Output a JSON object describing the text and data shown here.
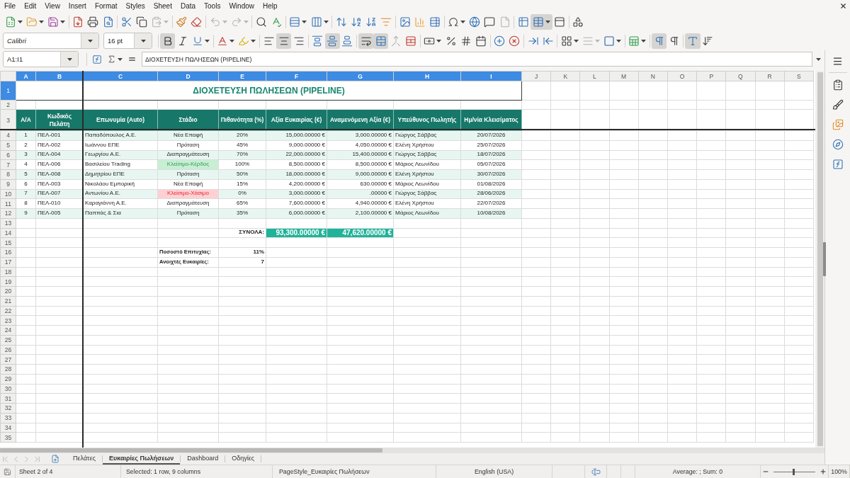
{
  "menu_bar": [
    "File",
    "Edit",
    "View",
    "Insert",
    "Format",
    "Styles",
    "Sheet",
    "Data",
    "Tools",
    "Window",
    "Help"
  ],
  "standard_toolbar": [
    [
      {
        "kind": "new",
        "active": false,
        "disabled": false
      },
      {
        "kind": "open",
        "active": false,
        "disabled": false
      },
      {
        "kind": "save",
        "active": false,
        "disabled": false
      }
    ],
    [
      {
        "kind": "export_pdf",
        "active": false,
        "disabled": false
      },
      {
        "kind": "print",
        "active": false,
        "disabled": false
      },
      {
        "kind": "print_preview",
        "active": false,
        "disabled": false
      }
    ],
    [
      {
        "kind": "cut",
        "active": false,
        "disabled": false
      },
      {
        "kind": "copy",
        "active": false,
        "disabled": false
      },
      {
        "kind": "paste",
        "active": false,
        "disabled": true
      }
    ],
    [
      {
        "kind": "clone_formatting",
        "active": false,
        "disabled": false
      },
      {
        "kind": "clear_formatting",
        "active": false,
        "disabled": false
      }
    ],
    [
      {
        "kind": "undo",
        "active": false,
        "disabled": true
      },
      {
        "kind": "redo",
        "active": false,
        "disabled": true
      }
    ],
    [
      {
        "kind": "find_replace",
        "active": false,
        "disabled": false
      },
      {
        "kind": "spelling",
        "active": false,
        "disabled": false
      }
    ],
    [
      {
        "kind": "row",
        "active": false,
        "disabled": false
      },
      {
        "kind": "column",
        "active": false,
        "disabled": false
      }
    ],
    [
      {
        "kind": "sort",
        "active": false,
        "disabled": false
      },
      {
        "kind": "sort_ascending",
        "active": false,
        "disabled": false
      },
      {
        "kind": "sort_descending",
        "active": false,
        "disabled": false
      },
      {
        "kind": "autofilter",
        "active": false,
        "disabled": false
      }
    ],
    [
      {
        "kind": "image",
        "active": false,
        "disabled": false
      },
      {
        "kind": "chart",
        "active": false,
        "disabled": false
      },
      {
        "kind": "pivot_table",
        "active": false,
        "disabled": false
      }
    ],
    [
      {
        "kind": "special_character",
        "active": false,
        "disabled": false
      },
      {
        "kind": "hyperlink",
        "active": false,
        "disabled": false
      },
      {
        "kind": "comment",
        "active": false,
        "disabled": false
      },
      {
        "kind": "header_footer",
        "active": false,
        "disabled": true
      }
    ],
    [
      {
        "kind": "print_area",
        "active": false,
        "disabled": false
      },
      {
        "kind": "freeze",
        "active": true,
        "disabled": false
      },
      {
        "kind": "split_window",
        "active": false,
        "disabled": false
      }
    ],
    [
      {
        "kind": "shapes",
        "active": false,
        "disabled": false
      }
    ]
  ],
  "font": {
    "name": "Calibri",
    "size": "16 pt"
  },
  "format_toolbar": [
    [
      {
        "kind": "bold",
        "active": true,
        "disabled": false
      },
      {
        "kind": "italic",
        "active": false,
        "disabled": false
      },
      {
        "kind": "underline",
        "active": false,
        "disabled": false
      }
    ],
    [
      {
        "kind": "font_color",
        "active": false,
        "disabled": false
      },
      {
        "kind": "highlight",
        "active": false,
        "disabled": false
      }
    ],
    [
      {
        "kind": "align_left",
        "active": false,
        "disabled": false
      },
      {
        "kind": "align_center",
        "active": true,
        "disabled": false
      },
      {
        "kind": "align_right",
        "active": false,
        "disabled": false
      }
    ],
    [
      {
        "kind": "align_top",
        "active": false,
        "disabled": false
      },
      {
        "kind": "align_middle",
        "active": true,
        "disabled": false
      },
      {
        "kind": "align_bottom",
        "active": false,
        "disabled": false
      }
    ],
    [
      {
        "kind": "wrap_text",
        "active": true,
        "disabled": false
      },
      {
        "kind": "merge_center",
        "active": true,
        "disabled": false
      },
      {
        "kind": "merge",
        "active": false,
        "disabled": true
      },
      {
        "kind": "unmerge",
        "active": false,
        "disabled": false
      }
    ],
    [
      {
        "kind": "currency",
        "active": false,
        "disabled": false
      },
      {
        "kind": "percent",
        "active": false,
        "disabled": false
      },
      {
        "kind": "number",
        "active": false,
        "disabled": false
      },
      {
        "kind": "date",
        "active": false,
        "disabled": false
      }
    ],
    [
      {
        "kind": "add_decimal",
        "active": false,
        "disabled": false
      },
      {
        "kind": "delete_decimal",
        "active": false,
        "disabled": false
      }
    ],
    [
      {
        "kind": "indent_increase",
        "active": false,
        "disabled": false
      },
      {
        "kind": "indent_decrease",
        "active": false,
        "disabled": false
      }
    ],
    [
      {
        "kind": "borders",
        "active": false,
        "disabled": false
      },
      {
        "kind": "border_style",
        "active": false,
        "disabled": true
      },
      {
        "kind": "border_color",
        "active": false,
        "disabled": false
      }
    ],
    [
      {
        "kind": "conditional",
        "active": false,
        "disabled": false
      }
    ],
    [
      {
        "kind": "left_to_right",
        "active": true,
        "disabled": false
      },
      {
        "kind": "right_to_left",
        "active": false,
        "disabled": false
      }
    ],
    [
      {
        "kind": "text_horizontal",
        "active": true,
        "disabled": false
      },
      {
        "kind": "text_vertical",
        "active": false,
        "disabled": false
      }
    ]
  ],
  "formula_bar": {
    "name_box": "A1:I1",
    "content": "ΔΙΟΧΕΤΕΥΣΗ ΠΩΛΗΣΕΩΝ (PIPELINE)"
  },
  "sheet": {
    "columns": [
      {
        "label": "A",
        "selected": true
      },
      {
        "label": "B",
        "selected": true
      },
      {
        "label": "C",
        "selected": true
      },
      {
        "label": "D",
        "selected": true
      },
      {
        "label": "E",
        "selected": true
      },
      {
        "label": "F",
        "selected": true
      },
      {
        "label": "G",
        "selected": true
      },
      {
        "label": "H",
        "selected": true
      },
      {
        "label": "I",
        "selected": true
      },
      {
        "label": "J",
        "selected": false
      },
      {
        "label": "K",
        "selected": false
      },
      {
        "label": "L",
        "selected": false
      },
      {
        "label": "M",
        "selected": false
      },
      {
        "label": "N",
        "selected": false
      },
      {
        "label": "O",
        "selected": false
      },
      {
        "label": "P",
        "selected": false
      },
      {
        "label": "Q",
        "selected": false
      },
      {
        "label": "R",
        "selected": false
      },
      {
        "label": "S",
        "selected": false
      }
    ],
    "row_numbers": [
      {
        "label": "1",
        "selected": true
      },
      {
        "label": "2",
        "selected": false
      },
      {
        "label": "3",
        "selected": false
      },
      {
        "label": "4",
        "selected": false
      },
      {
        "label": "5",
        "selected": false
      },
      {
        "label": "6",
        "selected": false
      },
      {
        "label": "7",
        "selected": false
      },
      {
        "label": "8",
        "selected": false
      },
      {
        "label": "9",
        "selected": false
      },
      {
        "label": "10",
        "selected": false
      },
      {
        "label": "11",
        "selected": false
      },
      {
        "label": "12",
        "selected": false
      },
      {
        "label": "13",
        "selected": false
      },
      {
        "label": "14",
        "selected": false
      },
      {
        "label": "15",
        "selected": false
      },
      {
        "label": "16",
        "selected": false
      },
      {
        "label": "17",
        "selected": false
      },
      {
        "label": "18",
        "selected": false
      },
      {
        "label": "19",
        "selected": false
      },
      {
        "label": "20",
        "selected": false
      },
      {
        "label": "21",
        "selected": false
      },
      {
        "label": "22",
        "selected": false
      },
      {
        "label": "23",
        "selected": false
      },
      {
        "label": "24",
        "selected": false
      },
      {
        "label": "25",
        "selected": false
      },
      {
        "label": "26",
        "selected": false
      },
      {
        "label": "27",
        "selected": false
      },
      {
        "label": "28",
        "selected": false
      },
      {
        "label": "29",
        "selected": false
      },
      {
        "label": "30",
        "selected": false
      },
      {
        "label": "31",
        "selected": false
      },
      {
        "label": "32",
        "selected": false
      },
      {
        "label": "33",
        "selected": false
      },
      {
        "label": "34",
        "selected": false
      },
      {
        "label": "35",
        "selected": false
      }
    ],
    "title": "ΔΙΟΧΕΤΕΥΣΗ ΠΩΛΗΣΕΩΝ (PIPELINE)",
    "headers": [
      "Α/Α",
      "Κωδικός Πελάτη",
      "Επωνυμία (Auto)",
      "Στάδιο",
      "Πιθανότητα (%)",
      "Αξία Ευκαιρίας (€)",
      "Αναμενόμενη Αξία (€)",
      "Υπεύθυνος Πωλητής",
      "Ημ/νία Κλεισίματος"
    ],
    "records": [
      {
        "kind": "open",
        "cells": [
          "1",
          "ΠΕΛ-001",
          "Παπαδόπουλος Α.Ε.",
          "Νέα Επαφή",
          "20%",
          "15,000.00000 €",
          "3,000.00000 €",
          "Γιώργος Σάββας",
          "20/07/2026"
        ]
      },
      {
        "kind": "open",
        "cells": [
          "2",
          "ΠΕΛ-002",
          "Ιωάννου ΕΠΕ",
          "Πρόταση",
          "45%",
          "9,000.00000 €",
          "4,050.00000 €",
          "Ελένη Χρήστου",
          "25/07/2026"
        ]
      },
      {
        "kind": "open",
        "cells": [
          "3",
          "ΠΕΛ-004",
          "Γεωργίου Α.Ε.",
          "Διαπραγμάτευση",
          "70%",
          "22,000.00000 €",
          "15,400.00000 €",
          "Γιώργος Σάββας",
          "18/07/2026"
        ]
      },
      {
        "kind": "won",
        "cells": [
          "4",
          "ΠΕΛ-006",
          "Βασιλείου Trading",
          "Κλείσιμο-Κέρδος",
          "100%",
          "8,500.00000 €",
          "8,500.00000 €",
          "Μάριος Λεωνίδου",
          "05/07/2026"
        ]
      },
      {
        "kind": "open",
        "cells": [
          "5",
          "ΠΕΛ-008",
          "Δημητρίου ΕΠΕ",
          "Πρόταση",
          "50%",
          "18,000.00000 €",
          "9,000.00000 €",
          "Ελένη Χρήστου",
          "30/07/2026"
        ]
      },
      {
        "kind": "open",
        "cells": [
          "6",
          "ΠΕΛ-003",
          "Νικολάου Εμπορική",
          "Νέα Επαφή",
          "15%",
          "4,200.00000 €",
          "630.00000 €",
          "Μάριος Λεωνίδου",
          "01/08/2026"
        ]
      },
      {
        "kind": "lost",
        "cells": [
          "7",
          "ΠΕΛ-007",
          "Αντωνίου Α.Ε.",
          "Κλείσιμο-Χάσιμο",
          "0%",
          "3,000.00000 €",
          ".00000 €",
          "Γιώργος Σάββας",
          "28/06/2026"
        ]
      },
      {
        "kind": "open",
        "cells": [
          "8",
          "ΠΕΛ-010",
          "Καραγιάννη Α.Ε.",
          "Διαπραγμάτευση",
          "65%",
          "7,600.00000 €",
          "4,940.00000 €",
          "Ελένη Χρήστου",
          "22/07/2026"
        ]
      },
      {
        "kind": "open",
        "cells": [
          "9",
          "ΠΕΛ-005",
          "Παππάς & Σια",
          "Πρόταση",
          "35%",
          "6,000.00000 €",
          "2,100.00000 €",
          "Μάριος Λεωνίδου",
          "10/08/2026"
        ]
      }
    ],
    "totals": {
      "label": "ΣΥΝΟΛΑ:",
      "value": "93,300.00000 €",
      "expected": "47,620.00000 €"
    },
    "stats": [
      {
        "label": "Ποσοστό Επιτυχίας:",
        "value": "11%"
      },
      {
        "label": "Ανοιχτές Ευκαιρίες:",
        "value": "7"
      }
    ]
  },
  "sheet_tabs": [
    {
      "label": "Πελάτες",
      "selected": false
    },
    {
      "label": "Ευκαιρίες Πωλήσεων",
      "selected": true
    },
    {
      "label": "Dashboard",
      "selected": false
    },
    {
      "label": "Οδηγίες",
      "selected": false
    }
  ],
  "status_bar": {
    "sheet": "Sheet 2 of 4",
    "selection": "Selected: 1 row, 9 columns",
    "page_style": "PageStyle_Ευκαιρίες Πωλήσεων",
    "language": "English (USA)",
    "summary": "Average: ; Sum: 0",
    "zoom": {
      "level": 0.48,
      "reading": "100%"
    }
  }
}
